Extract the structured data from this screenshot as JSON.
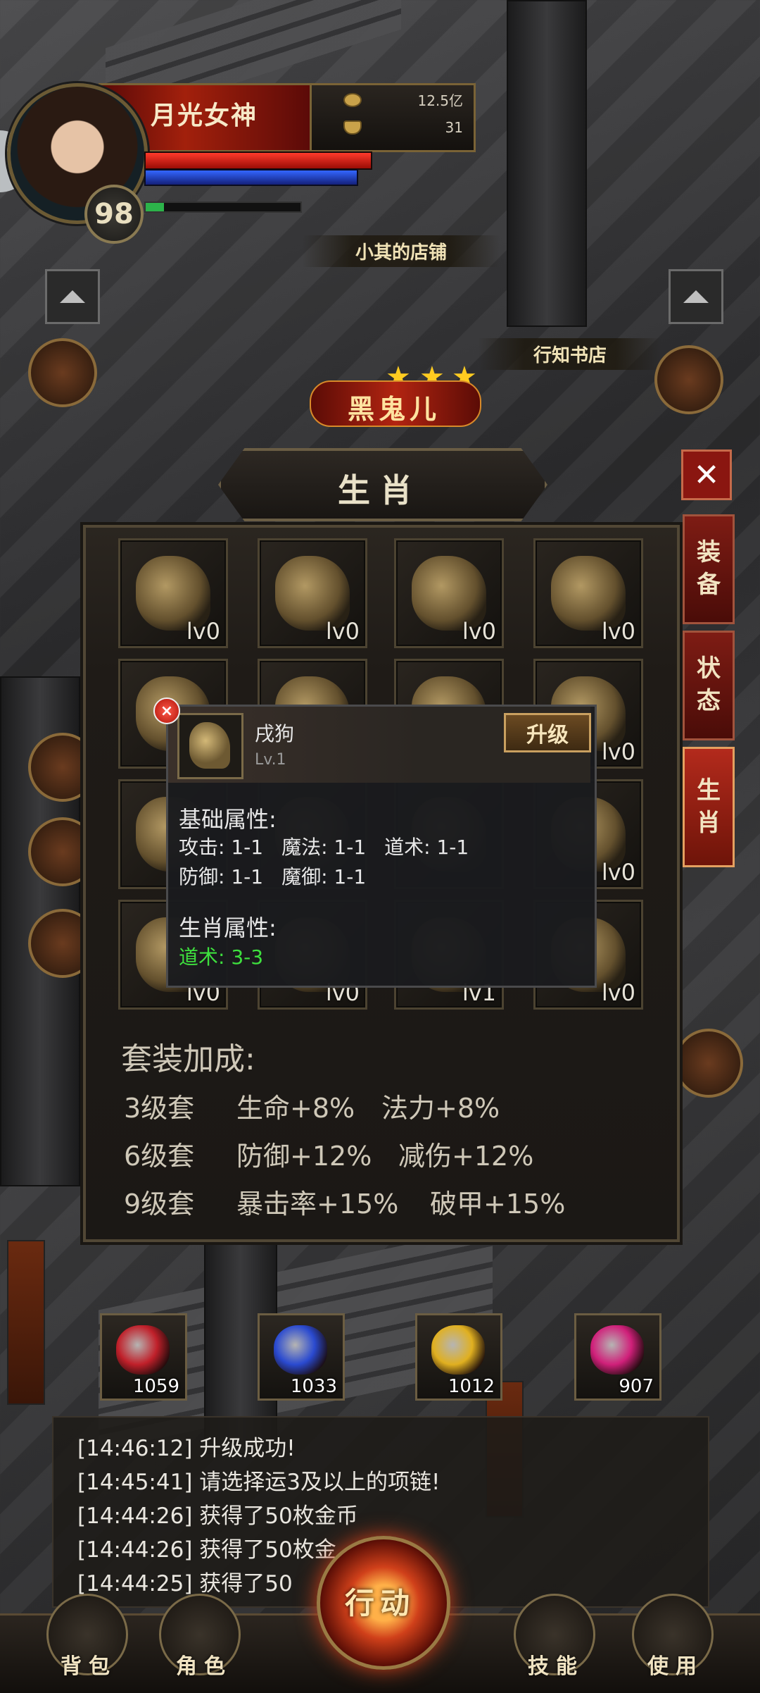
{
  "player": {
    "name": "月光女神",
    "level": "98",
    "xp_fraction": 0.12
  },
  "currency": {
    "gold": "12.5亿",
    "ingot": "31"
  },
  "world": {
    "shop_label": "小其的店铺",
    "bookstore_label": "行知书店",
    "boss_name": "黑鬼儿",
    "boss_stars": 3
  },
  "panel": {
    "title": "生肖",
    "close": "✕",
    "tabs": [
      {
        "label": "装备",
        "chars": [
          "装",
          "备"
        ],
        "active": false
      },
      {
        "label": "状态",
        "chars": [
          "状",
          "态"
        ],
        "active": false
      },
      {
        "label": "生肖",
        "chars": [
          "生",
          "肖"
        ],
        "active": true
      }
    ],
    "slots": [
      {
        "level": "lv0"
      },
      {
        "level": "lv0"
      },
      {
        "level": "lv0"
      },
      {
        "level": "lv0"
      },
      {
        "level": ""
      },
      {
        "level": ""
      },
      {
        "level": ""
      },
      {
        "level": "lv0"
      },
      {
        "level": ""
      },
      {
        "level": ""
      },
      {
        "level": ""
      },
      {
        "level": "lv0"
      },
      {
        "level": "lv0"
      },
      {
        "level": "lv0"
      },
      {
        "level": "lv1"
      },
      {
        "level": "lv0"
      }
    ],
    "set_bonus": {
      "title": "套装加成:",
      "rows": [
        {
          "tier": "3级套",
          "a": "生命+8%",
          "b": "法力+8%"
        },
        {
          "tier": "6级套",
          "a": "防御+12%",
          "b": "减伤+12%"
        },
        {
          "tier": "9级套",
          "a": "暴击率+15%",
          "b": "破甲+15%"
        }
      ]
    }
  },
  "tooltip": {
    "name": "戌狗",
    "level": "Lv.1",
    "upgrade": "升级",
    "base_title": "基础属性:",
    "base_line1": [
      "攻击: 1-1",
      "魔法: 1-1",
      "道术: 1-1"
    ],
    "base_line2": [
      "防御: 1-1",
      "魔御: 1-1"
    ],
    "zodiac_title": "生肖属性:",
    "zodiac_attr": "道术: 3-3"
  },
  "potions": [
    {
      "count": "1059",
      "color": "#c0202a"
    },
    {
      "count": "1033",
      "color": "#2a4ad0"
    },
    {
      "count": "1012",
      "color": "#e0b020"
    },
    {
      "count": "907",
      "color": "#d0207a"
    }
  ],
  "chat": [
    "[14:46:12] 升级成功!",
    "[14:45:41] 请选择运3及以上的项链!",
    "[14:44:26] 获得了50枚金币",
    "[14:44:26] 获得了50枚金",
    "[14:44:25] 获得了50"
  ],
  "nav": {
    "bag": "背包",
    "role": "角色",
    "action": "行动",
    "skill": "技能",
    "use": "使用"
  }
}
